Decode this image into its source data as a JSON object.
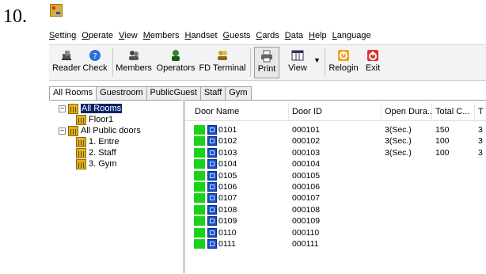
{
  "doc_number": "10.",
  "menu": [
    "Setting",
    "Operate",
    "View",
    "Members",
    "Handset",
    "Guests",
    "Cards",
    "Data",
    "Help",
    "Language"
  ],
  "toolbar": {
    "reader": "Reader",
    "check": "Check",
    "members": "Members",
    "operators": "Operators",
    "fd_terminal": "FD Terminal",
    "print": "Print",
    "view": "View",
    "relogin": "Relogin",
    "exit": "Exit"
  },
  "tabs": [
    "All Rooms",
    "Guestroom",
    "PublicGuest",
    "Staff",
    "Gym"
  ],
  "tree": {
    "all_rooms": "All Rooms",
    "floor1": "Floor1",
    "all_public_doors": "All Public doors",
    "entre": "1. Entre",
    "staff": "2. Staff",
    "gym": "3. Gym"
  },
  "grid": {
    "headers": [
      "Door Name",
      "Door ID",
      "Open Dura...",
      "Total C...",
      "T"
    ],
    "rows": [
      {
        "name": "0101",
        "id": "000101",
        "open": "3(Sec.)",
        "total": "150",
        "t": "3"
      },
      {
        "name": "0102",
        "id": "000102",
        "open": "3(Sec.)",
        "total": "100",
        "t": "3"
      },
      {
        "name": "0103",
        "id": "000103",
        "open": "3(Sec.)",
        "total": "100",
        "t": "3"
      },
      {
        "name": "0104",
        "id": "000104",
        "open": "",
        "total": "",
        "t": ""
      },
      {
        "name": "0105",
        "id": "000105",
        "open": "",
        "total": "",
        "t": ""
      },
      {
        "name": "0106",
        "id": "000106",
        "open": "",
        "total": "",
        "t": ""
      },
      {
        "name": "0107",
        "id": "000107",
        "open": "",
        "total": "",
        "t": ""
      },
      {
        "name": "0108",
        "id": "000108",
        "open": "",
        "total": "",
        "t": ""
      },
      {
        "name": "0109",
        "id": "000109",
        "open": "",
        "total": "",
        "t": ""
      },
      {
        "name": "0110",
        "id": "000110",
        "open": "",
        "total": "",
        "t": ""
      },
      {
        "name": "0111",
        "id": "000111",
        "open": "",
        "total": "",
        "t": ""
      }
    ]
  },
  "colors": {
    "status_ok": "#18d418",
    "selection": "#0a246a",
    "door_icon": "#1450c8"
  }
}
